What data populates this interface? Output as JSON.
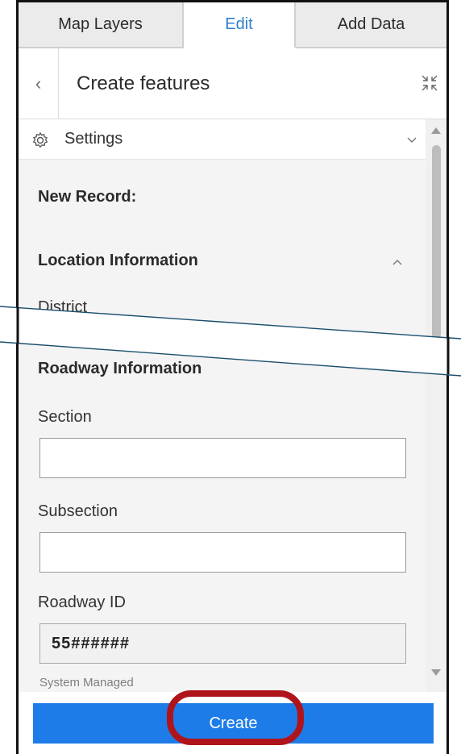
{
  "tabs": [
    {
      "label": "Map Layers"
    },
    {
      "label": "Edit"
    },
    {
      "label": "Add Data"
    }
  ],
  "header": {
    "title": "Create features",
    "back_icon": "chevron-left-icon",
    "collapse_icon": "collapse-icon"
  },
  "settings": {
    "label": "Settings"
  },
  "form": {
    "new_record": "New Record:",
    "location_section": "Location Information",
    "district_label": "District",
    "roadway_section": "Roadway Information",
    "section_label": "Section",
    "section_value": "",
    "subsection_label": "Subsection",
    "subsection_value": "",
    "roadway_id_label": "Roadway ID",
    "roadway_id_value": "55######",
    "roadway_id_hint": "System Managed"
  },
  "footer": {
    "create_label": "Create"
  },
  "colors": {
    "accent": "#1e7ce8",
    "tab_active": "#2f7fd0",
    "highlight": "#b0141b"
  }
}
